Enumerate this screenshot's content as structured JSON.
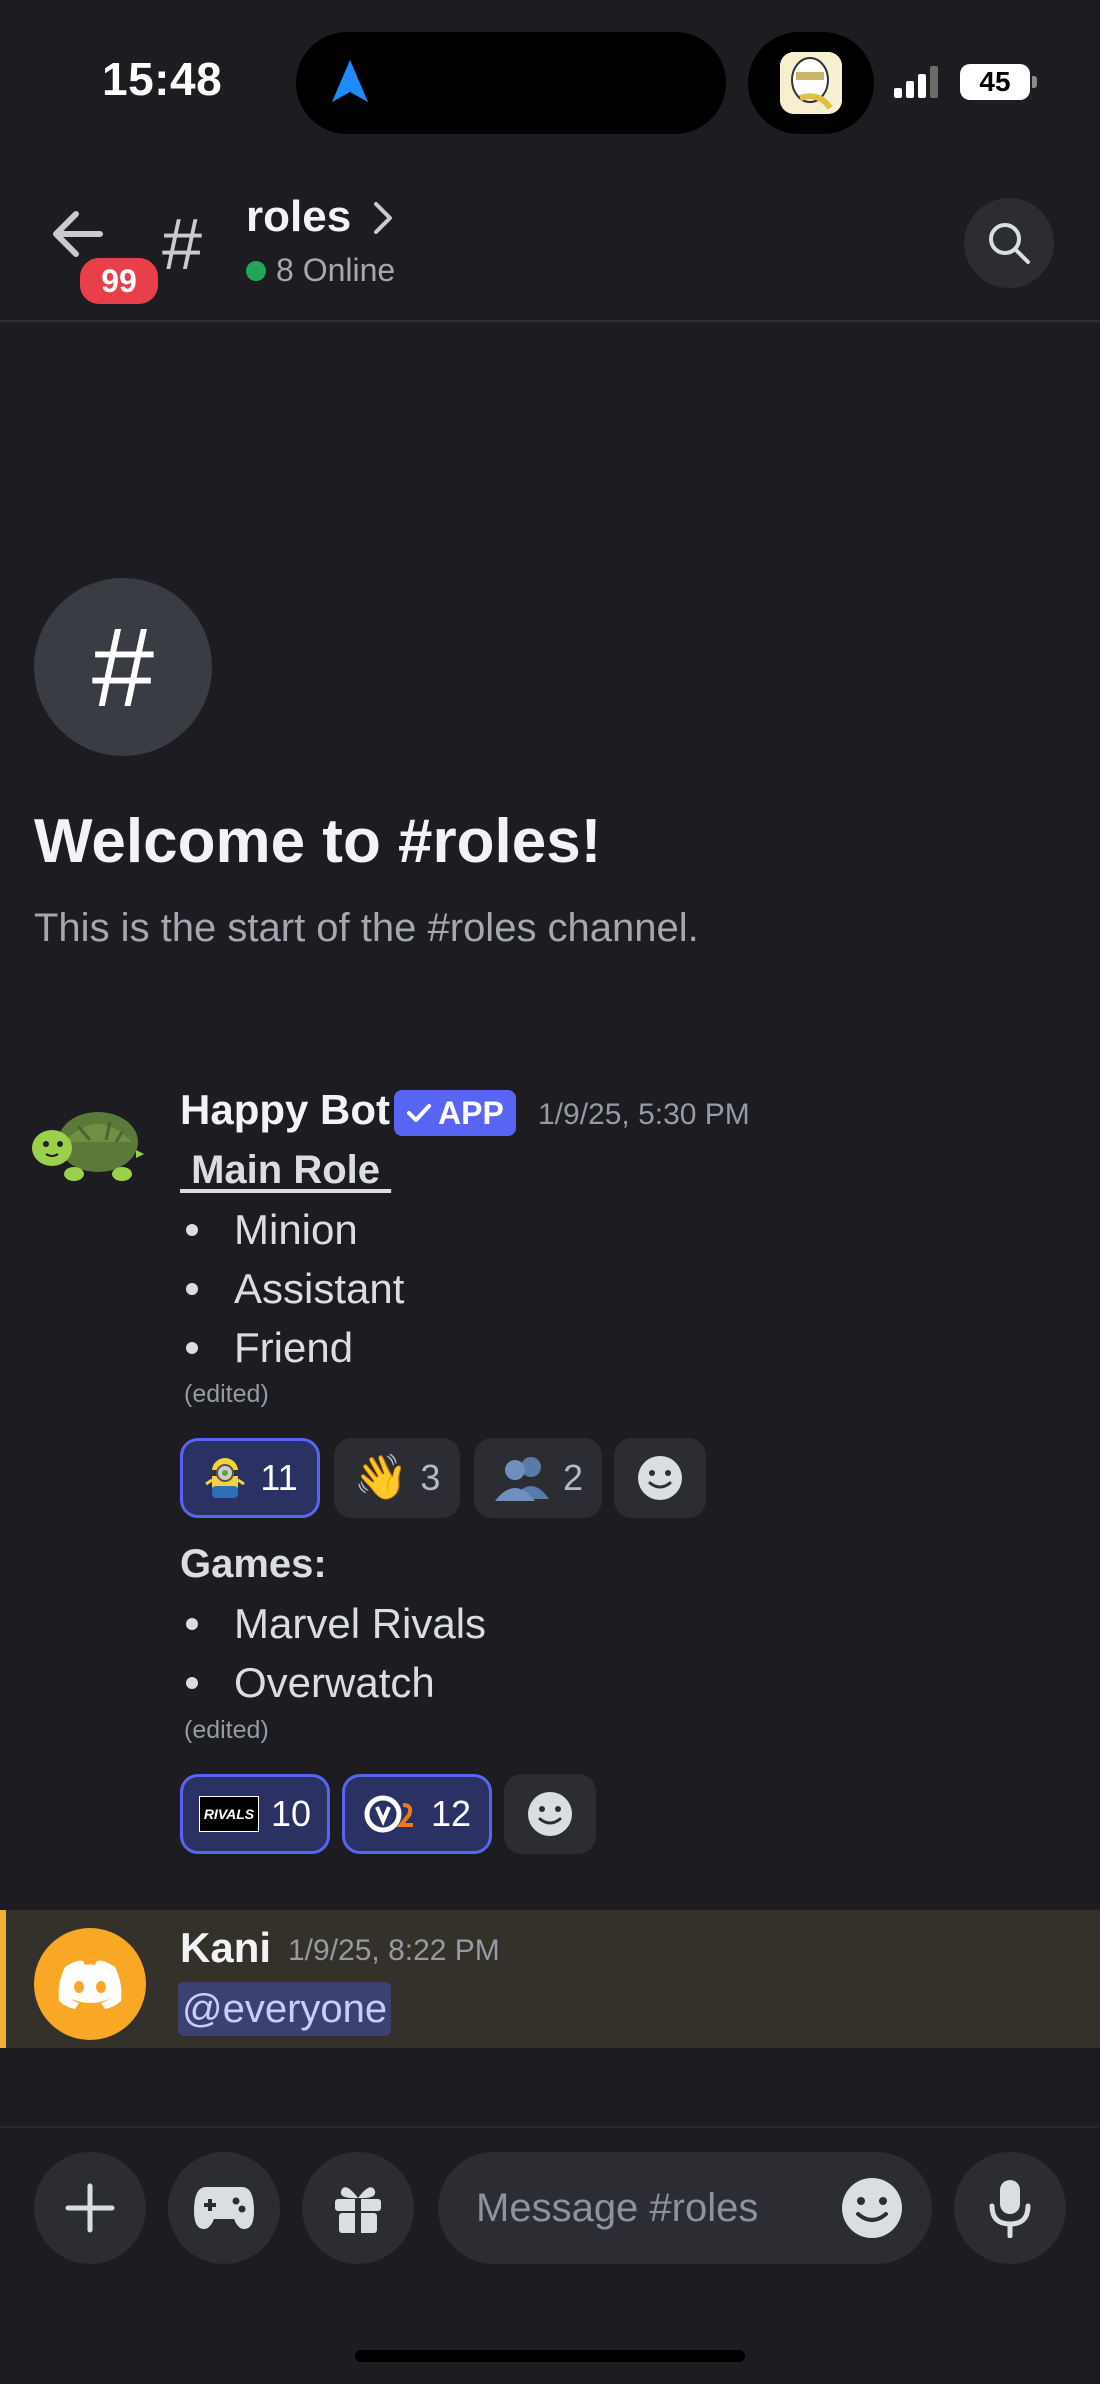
{
  "status_bar": {
    "time": "15:48",
    "battery": "45"
  },
  "header": {
    "unread_badge": "99",
    "channel_name": "roles",
    "online": "8 Online"
  },
  "welcome": {
    "title": "Welcome to #roles!",
    "subtitle": "This is the start of the #roles channel."
  },
  "messages": [
    {
      "author": "Happy Bot",
      "app_tag": "APP",
      "timestamp": "1/9/25, 5:30 PM",
      "section1_title": " Main Role ",
      "section1_items": [
        "Minion",
        "Assistant",
        "Friend"
      ],
      "edited": "(edited)",
      "reactions1": [
        {
          "emoji": "minion",
          "count": "11",
          "active": true
        },
        {
          "emoji": "👋",
          "count": "3",
          "active": false
        },
        {
          "emoji": "👥",
          "count": "2",
          "active": false
        }
      ],
      "section2_title": "Games:",
      "section2_items": [
        "Marvel Rivals",
        "Overwatch"
      ],
      "reactions2": [
        {
          "emoji": "rivals-logo",
          "count": "10",
          "active": true
        },
        {
          "emoji": "overwatch-logo",
          "count": "12",
          "active": true
        }
      ],
      "rivals_logo_text": "RIVALS"
    },
    {
      "author": "Kani",
      "timestamp": "1/9/25, 8:22 PM",
      "mention": "@everyone"
    }
  ],
  "composer": {
    "placeholder": "Message #roles"
  },
  "colors": {
    "accent": "#5865f2",
    "mention_bar": "#f0b232",
    "online": "#23a55a",
    "badge": "#e8404a"
  }
}
